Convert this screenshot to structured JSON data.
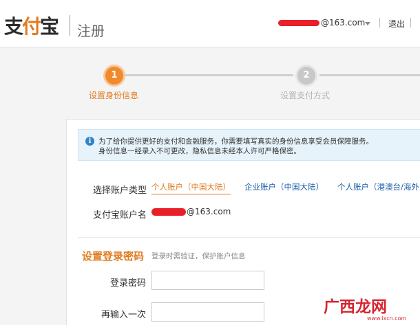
{
  "header": {
    "logo_text_left": "支",
    "logo_text_accent": "付",
    "logo_text_right": "宝",
    "page_title": "注册",
    "account_suffix": "@163.com",
    "logout_label": "退出"
  },
  "steps": [
    {
      "number": "1",
      "label": "设置身份信息",
      "state": "active"
    },
    {
      "number": "2",
      "label": "设置支付方式",
      "state": "inactive"
    }
  ],
  "notice": {
    "icon": "info-icon",
    "line1": "为了给你提供更好的支付和金融服务，你需要填写真实的身份信息享受会员保障服务。",
    "line2": "身份信息一经录入不可更改，隐私信息未经本人许可严格保密。"
  },
  "account_type": {
    "label": "选择账户类型",
    "options": [
      {
        "label": "个人账户（中国大陆）",
        "selected": true
      },
      {
        "label": "企业账户（中国大陆）",
        "selected": false
      },
      {
        "label": "个人账户（港澳台/海外",
        "selected": false
      }
    ]
  },
  "account_name": {
    "label": "支付宝账户名",
    "suffix": "@163.com"
  },
  "login_password": {
    "section_title": "设置登录密码",
    "section_hint": "登录时需验证，保护账户信息",
    "password_label": "登录密码",
    "password_value": "",
    "confirm_label": "再输入一次",
    "confirm_value": ""
  },
  "watermark": {
    "text": "广西龙网",
    "url": "www.ixcn.com"
  },
  "colors": {
    "accent_orange": "#e07b1f",
    "link_blue": "#1a5fa8",
    "notice_bg": "#e7f3fb",
    "redaction_red": "#e8202a"
  }
}
